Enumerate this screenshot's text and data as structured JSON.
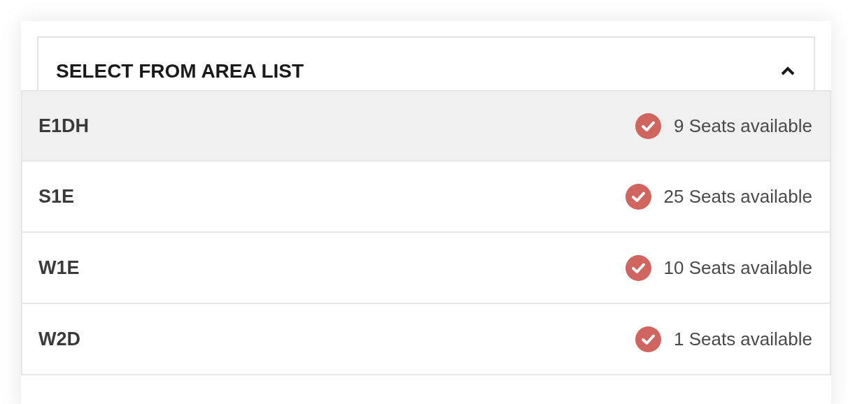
{
  "dropdown": {
    "label": "SELECT FROM AREA LIST",
    "expanded": true
  },
  "areas": [
    {
      "name": "E1DH",
      "availability": "9 Seats available",
      "selected": true
    },
    {
      "name": "S1E",
      "availability": "25 Seats available",
      "selected": false
    },
    {
      "name": "W1E",
      "availability": "10 Seats available",
      "selected": false
    },
    {
      "name": "W2D",
      "availability": "1 Seats available",
      "selected": false
    }
  ]
}
